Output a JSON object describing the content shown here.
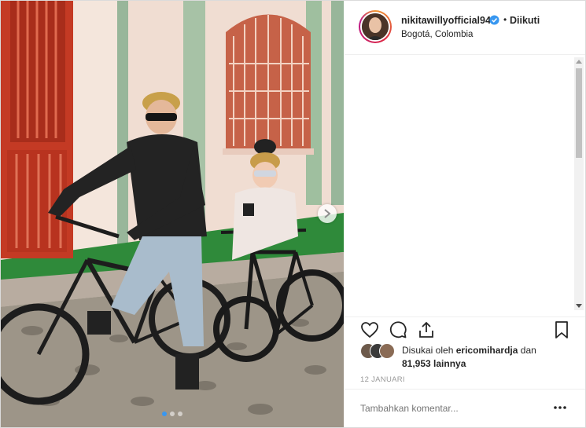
{
  "post": {
    "username": "nikitawillyofficial94",
    "follow_separator": "•",
    "follow_label": "Diikuti",
    "location": "Bogotá, Colombia"
  },
  "photo": {
    "subject": "two cyclists on mountain bikes in front of colonial building",
    "carousel_total": 3,
    "carousel_active": 1
  },
  "actions": {
    "like_icon": "heart-icon",
    "comment_icon": "comment-icon",
    "share_icon": "share-icon",
    "save_icon": "bookmark-icon"
  },
  "likes": {
    "prefix": "Disukai oleh",
    "liker": "ericomihardja",
    "joiner": "dan",
    "count": "81,953 lainnya"
  },
  "date": "12 JANUARI",
  "comment_box": {
    "placeholder": "Tambahkan komentar...",
    "more_icon": "more-options-icon"
  },
  "colors": {
    "verified": "#3897f0",
    "text": "#262626",
    "muted": "#999999",
    "border": "#efefef"
  }
}
